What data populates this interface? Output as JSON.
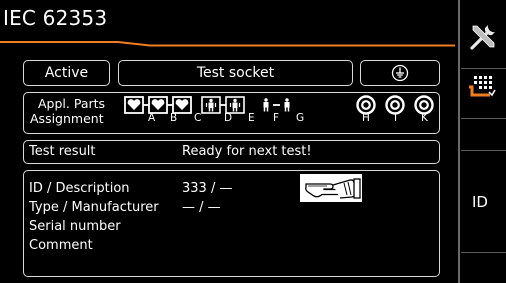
{
  "title": "IEC 62353",
  "status": {
    "mode_button": "Active",
    "socket_button": "Test socket",
    "ground_icon": "protective-earth-icon"
  },
  "applied_parts": {
    "label_line1": "Appl. Parts",
    "label_line2": "Assignment",
    "letters": [
      "A",
      "B",
      "C",
      "D",
      "E",
      "F",
      "G",
      "H",
      "I",
      "K"
    ]
  },
  "test_result": {
    "label": "Test result",
    "value": "Ready for next test!"
  },
  "info": {
    "id_label": "ID / Description",
    "id_value": "333 / —",
    "type_label": "Type / Manufacturer",
    "type_value": "— / —",
    "serial_label": "Serial number",
    "comment_label": "Comment",
    "pointer_icon": "pointing-hand-icon"
  },
  "sidebar": {
    "tools_icon": "tools-icon",
    "menu_icon": "keypad-selection-icon",
    "id_label": "ID"
  },
  "colors": {
    "accent": "#f07d1e",
    "border": "#d8d8d8"
  }
}
